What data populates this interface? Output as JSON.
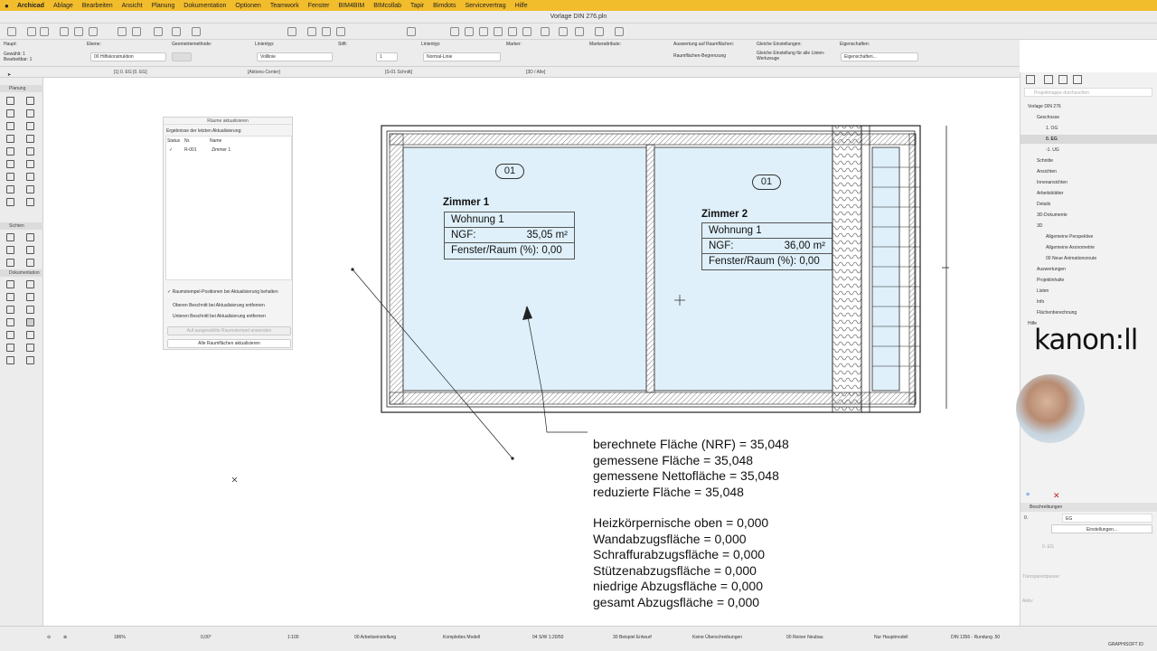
{
  "menubar": {
    "apple": "",
    "items": [
      "Archicad",
      "Ablage",
      "Bearbeiten",
      "Ansicht",
      "Planung",
      "Dokumentation",
      "Optionen",
      "Teamwork",
      "Fenster",
      "BIM4BIM",
      "BIMcollab",
      "Tapir",
      "Bimdots",
      "Servicevertrag",
      "Hilfe"
    ]
  },
  "window": {
    "title": "Vorlage DIN 276.pln"
  },
  "infobox": {
    "haupt_label": "Haupt:",
    "haupt_value1": "Gewählt: 1",
    "haupt_value2": "Bearbeitbar: 1",
    "ebene_label": "Ebene:",
    "ebene_value": "00 Hilfskonstruktion",
    "geometrie_label": "Geometriemethode:",
    "linientyp_label": "Linientyp:",
    "linientyp_value": "Volllinie",
    "stift_label": "Stift:",
    "stift_value": "1",
    "linientyp2_label": "Linientyp:",
    "linientyp2_value": "Normal-Linie",
    "marker_label": "Marker:",
    "markerattr_label": "Markerattribute:",
    "auswertung_label": "Auswertung auf Raumflächen:",
    "auswertung_value": "Raumflächen-Begrenzung",
    "gleiche_label": "Gleiche Einstellungen:",
    "gleiche_value": "Gleiche Einstellung für alle Linien-Werkzeuge",
    "eigenschaften_label": "Eigenschaften:",
    "eigenschaften_value": "Eigenschaften..."
  },
  "tabs": [
    "[1] 0. EG [0. EG]",
    "[Aktions-Center]",
    "[S-01 Schnitt]",
    "[3D / Alle]"
  ],
  "toolbox": {
    "sections": [
      "Planung",
      "Sichten",
      "Dokumentation"
    ]
  },
  "dialog": {
    "title": "Räume aktualisieren",
    "subtitle": "Ergebnisse der letzten Aktualisierung:",
    "col_status": "Status",
    "col_nr": "Nr.",
    "col_name": "Name",
    "row_check": "✓",
    "row_nr": "R-001",
    "row_name": "Zimmer 1",
    "opt1": "Raumstempel-Positionen bei Aktualisierung behalten",
    "opt2": "Oberen Beschnitt bei Aktualisierung entfernen",
    "opt3": "Unteren Beschnitt bei Aktualisierung entfernen",
    "btn_disabled": "Auf ausgewählte Raumstempel anwenden",
    "btn_all": "Alle Raumflächen aktualisieren"
  },
  "room1": {
    "badge": "01",
    "title": "Zimmer 1",
    "wohnung": "Wohnung 1",
    "ngf_label": "NGF:",
    "ngf_value": "35,05 m²",
    "fenster": "Fenster/Raum (%): 0,00"
  },
  "room2": {
    "badge": "01",
    "title": "Zimmer 2",
    "wohnung": "Wohnung 1",
    "ngf_label": "NGF:",
    "ngf_value": "36,00 m²",
    "fenster": "Fenster/Raum (%): 0,00"
  },
  "calc": {
    "lines1": [
      "berechnete Fläche (NRF) = 35,048",
      "gemessene Fläche = 35,048",
      "gemessene Nettofläche = 35,048",
      "reduzierte Fläche = 35,048"
    ],
    "lines2": [
      "Heizkörpernische oben = 0,000",
      "Wandabzugsfläche = 0,000",
      "Schraffurabzugsfläche = 0,000",
      "Stützenabzugsfläche = 0,000",
      "niedrige Abzugsfläche  = 0,000",
      "gesamt Abzugsfläche = 0,000"
    ]
  },
  "navigator": {
    "search_placeholder": "Projektmappe durchsuchen",
    "items": [
      {
        "label": "Vorlage DIN 276",
        "indent": 0,
        "selected": false
      },
      {
        "label": "Geschosse",
        "indent": 1,
        "selected": false
      },
      {
        "label": "1. OG",
        "indent": 2,
        "selected": false
      },
      {
        "label": "0. EG",
        "indent": 2,
        "selected": true
      },
      {
        "label": "-1. UG",
        "indent": 2,
        "selected": false
      },
      {
        "label": "Schnitte",
        "indent": 1,
        "selected": false
      },
      {
        "label": "Ansichten",
        "indent": 1,
        "selected": false
      },
      {
        "label": "Innenansichten",
        "indent": 1,
        "selected": false
      },
      {
        "label": "Arbeitsblätter",
        "indent": 1,
        "selected": false
      },
      {
        "label": "Details",
        "indent": 1,
        "selected": false
      },
      {
        "label": "3D-Dokumente",
        "indent": 1,
        "selected": false
      },
      {
        "label": "3D",
        "indent": 1,
        "selected": false
      },
      {
        "label": "Allgemeine Perspektive",
        "indent": 2,
        "selected": false
      },
      {
        "label": "Allgemeine Axonometrie",
        "indent": 2,
        "selected": false
      },
      {
        "label": "00 Neue Animationsroute",
        "indent": 2,
        "selected": false
      },
      {
        "label": "Auswertungen",
        "indent": 1,
        "selected": false
      },
      {
        "label": "Projektinhalte",
        "indent": 1,
        "selected": false
      },
      {
        "label": "Listen",
        "indent": 1,
        "selected": false
      },
      {
        "label": "Info",
        "indent": 1,
        "selected": false
      },
      {
        "label": "Flächenberechnung",
        "indent": 1,
        "selected": false
      },
      {
        "label": "Hilfe",
        "indent": 0,
        "selected": false
      }
    ],
    "beschreibungen": "Beschreibungen",
    "nr_label": "0.",
    "nr_value": "EG",
    "einstellungen": "Einstellungen...",
    "geschoss_ref": "0. EG",
    "transparent": "Transparentpause:",
    "aktiv": "Aktiv:"
  },
  "logo": "kanon:ll",
  "statusbar": {
    "zoom": "186%",
    "angle": "0,00°",
    "scale": "1:100",
    "arbeitseinstellung": "00 Arbeitseinstellung",
    "modell": "Komplettes Modell",
    "massstab": "04 S/W 1:20/50",
    "entwurf": "30 Beispiel Entwurf",
    "ueberschreibungen": "Keine Überschreibungen",
    "neubau": "00 Reiner Neubau",
    "hauptmodell": "Nur Hauptmodell",
    "din": "DIN 1356 - Rundung .50",
    "brand": "GRAPHISOFT ID"
  }
}
